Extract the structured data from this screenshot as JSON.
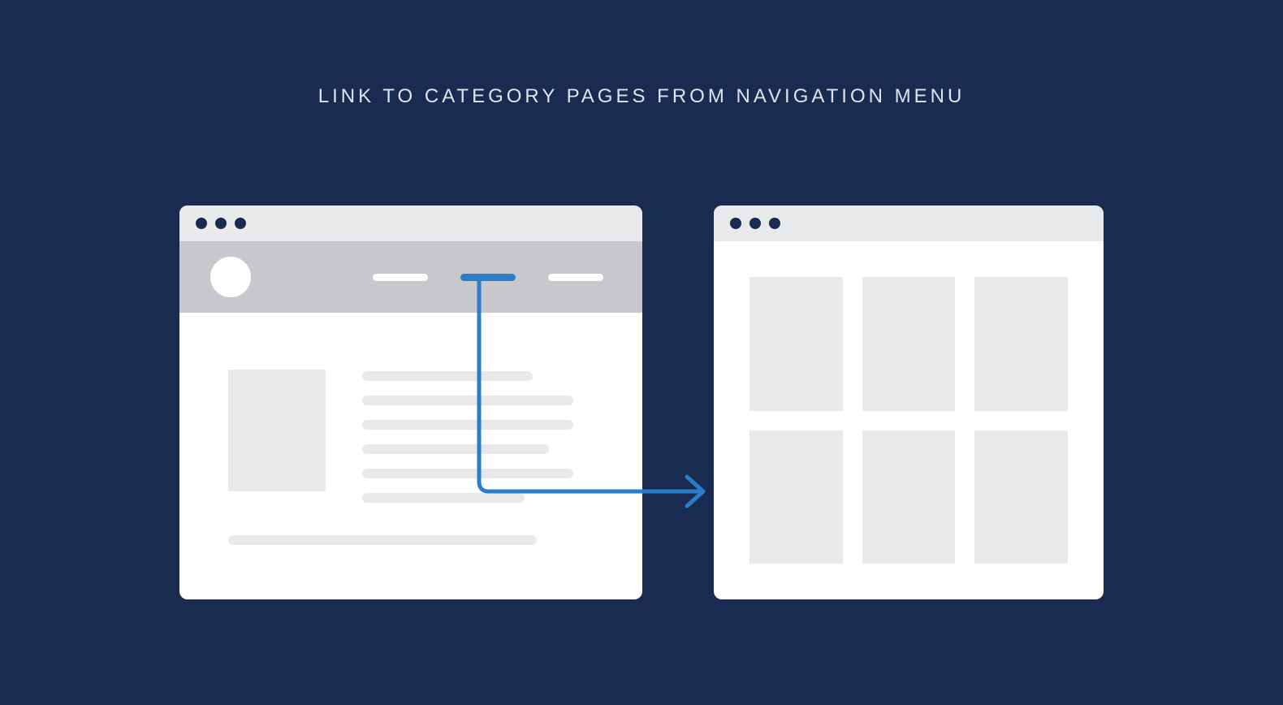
{
  "title": "LINK TO CATEGORY PAGES FROM NAVIGATION MENU",
  "colors": {
    "background": "#1a2b52",
    "accent": "#2a7dc9",
    "panel_light": "#e8e9eb",
    "panel_mid": "#c7c8cc",
    "white": "#ffffff"
  },
  "left_browser": {
    "nav_links_count": 3,
    "highlighted_index": 1
  },
  "right_browser": {
    "grid_rows": 2,
    "grid_cols": 3
  }
}
